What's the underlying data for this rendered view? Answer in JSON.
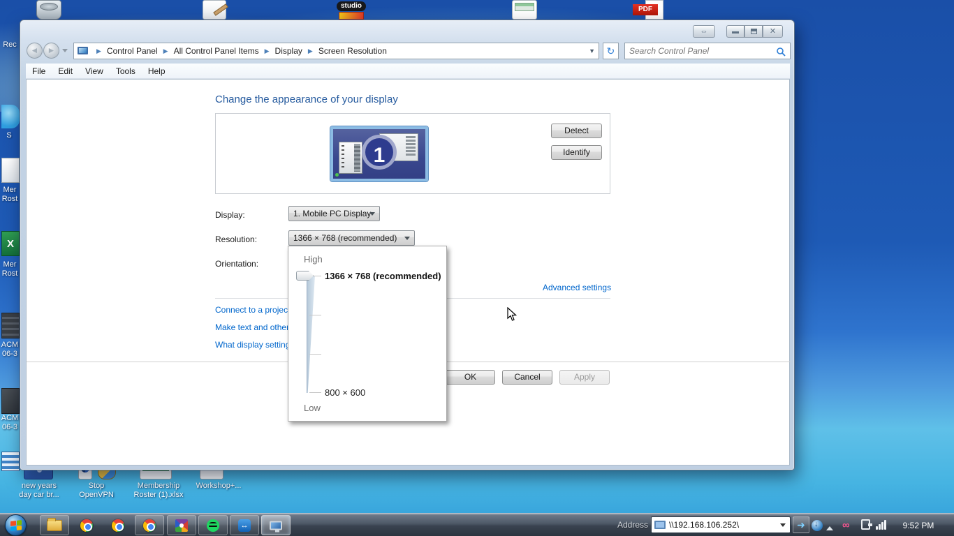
{
  "window": {
    "breadcrumb": {
      "items": [
        "Control Panel",
        "All Control Panel Items",
        "Display",
        "Screen Resolution"
      ]
    },
    "search_placeholder": "Search Control Panel",
    "menu": [
      "File",
      "Edit",
      "View",
      "Tools",
      "Help"
    ],
    "content": {
      "heading": "Change the appearance of your display",
      "monitor_number": "1",
      "detect": "Detect",
      "identify": "Identify",
      "display_label": "Display:",
      "display_value": "1. Mobile PC Display",
      "resolution_label": "Resolution:",
      "resolution_value": "1366 × 768 (recommended)",
      "orientation_label": "Orientation:",
      "advanced_link": "Advanced settings",
      "links": [
        "Connect to a projec",
        "Make text and other",
        "What display setting"
      ],
      "ok": "OK",
      "cancel": "Cancel",
      "apply": "Apply"
    },
    "popup": {
      "high": "High",
      "selected": "1366 × 768 (recommended)",
      "min": "800 × 600",
      "low": "Low"
    }
  },
  "desktop": {
    "studio_label": "studio",
    "pdf_label": "PDF",
    "teamviewer_glyph": "↔",
    "left_labels": [
      "Rec",
      "S",
      "Mer\nRost",
      "Mer\nRost",
      "ACM\n06-3",
      "ACM\n06-3"
    ],
    "excel_glyph": "X",
    "bottom_labels": [
      "new years\nday car br...",
      "Stop\nOpenVPN",
      "Membership\nRoster (1).xlsx",
      "Workshop+..."
    ]
  },
  "taskbar": {
    "address_label": "Address",
    "address_value": "\\\\192.168.106.252\\",
    "go_glyph": "➜",
    "infinity_glyph": "∞",
    "clock": "9:52 PM"
  },
  "colors": {
    "link": "#0066cc",
    "heading": "#255a9e",
    "desktop_top": "#1a4fa8"
  }
}
